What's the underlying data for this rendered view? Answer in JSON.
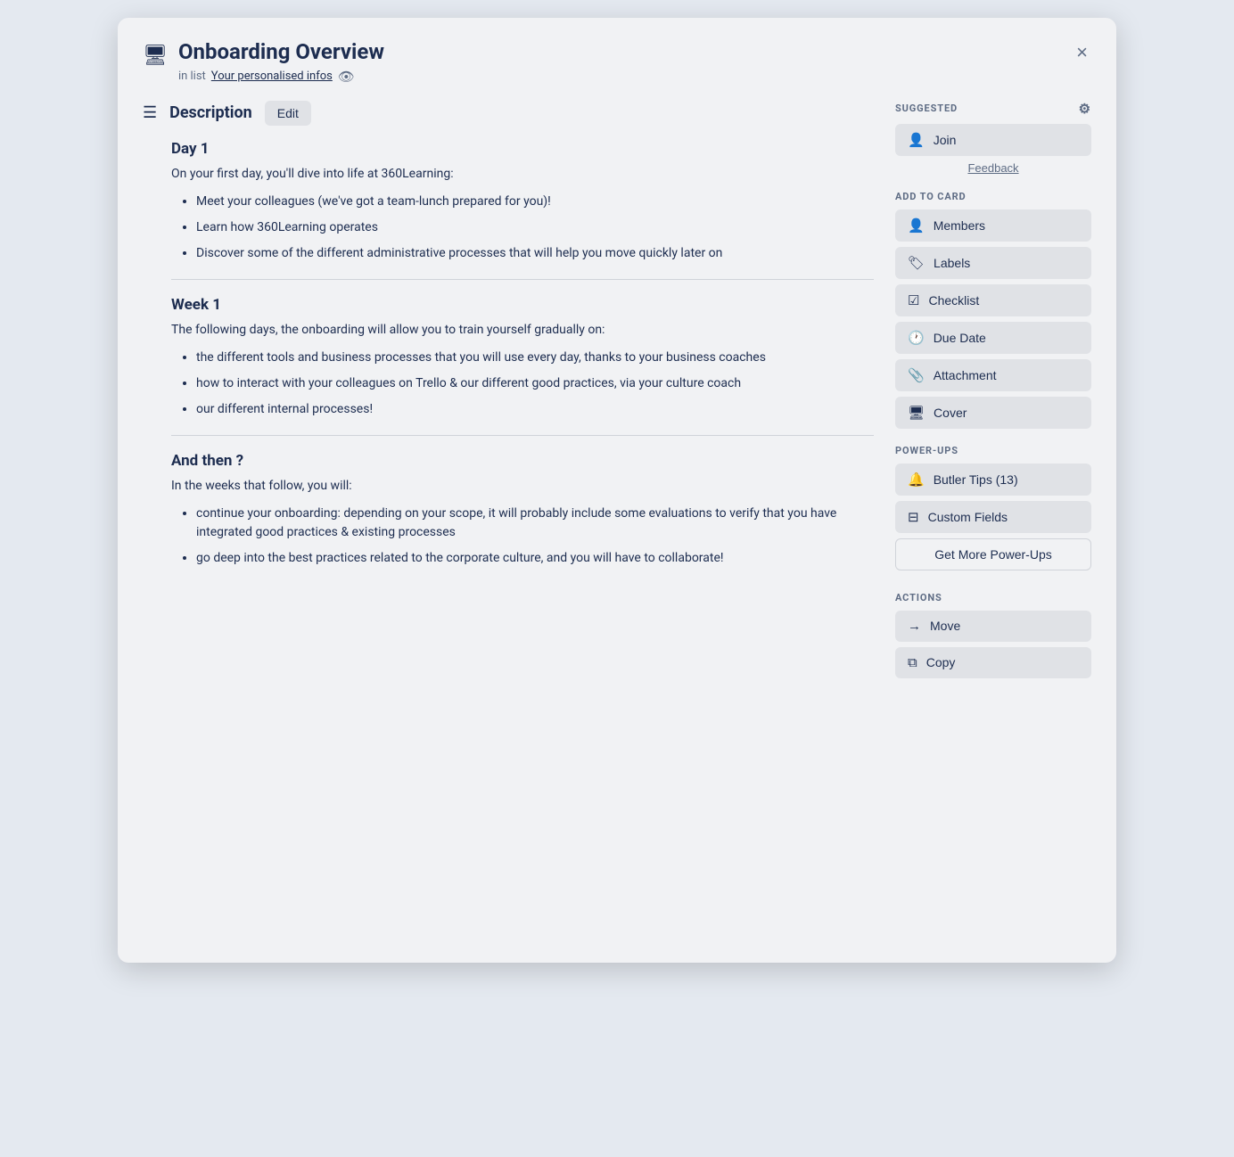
{
  "modal": {
    "title": "Onboarding Overview",
    "list_prefix": "in list",
    "list_name": "Your personalised infos",
    "close_label": "×"
  },
  "description": {
    "label": "Description",
    "edit_button": "Edit",
    "sections": [
      {
        "heading": "Day 1",
        "intro": "On your first day, you'll dive into life at 360Learning:",
        "bullets": [
          "Meet your colleagues (we've got a team-lunch prepared for you)!",
          "Learn how 360Learning operates",
          "Discover some of the different administrative processes that will help you move quickly later on"
        ]
      },
      {
        "heading": "Week 1",
        "intro": "The following days, the onboarding will allow you to train yourself gradually on:",
        "bullets": [
          "the different tools and business processes that you will use every day, thanks to your business coaches",
          "how to interact with your colleagues on Trello & our different good practices, via your culture coach",
          "our different internal processes!"
        ]
      },
      {
        "heading": "And then ?",
        "intro": "In the weeks that follow, you will:",
        "bullets": [
          "continue your onboarding: depending on your scope, it will probably include some evaluations to verify that you have integrated good practices & existing processes",
          "go deep into the best practices related to the corporate culture, and you will have to collaborate!"
        ]
      }
    ]
  },
  "sidebar": {
    "suggested_label": "SUGGESTED",
    "join_label": "Join",
    "feedback_label": "Feedback",
    "add_to_card_label": "ADD TO CARD",
    "buttons": [
      {
        "id": "members",
        "label": "Members",
        "icon": "👤"
      },
      {
        "id": "labels",
        "label": "Labels",
        "icon": "🏷"
      },
      {
        "id": "checklist",
        "label": "Checklist",
        "icon": "☑"
      },
      {
        "id": "due-date",
        "label": "Due Date",
        "icon": "🕐"
      },
      {
        "id": "attachment",
        "label": "Attachment",
        "icon": "📎"
      },
      {
        "id": "cover",
        "label": "Cover",
        "icon": "🖥"
      }
    ],
    "power_ups_label": "POWER-UPS",
    "power_ups": [
      {
        "id": "butler-tips",
        "label": "Butler Tips (13)",
        "icon": "🔔"
      },
      {
        "id": "custom-fields",
        "label": "Custom Fields",
        "icon": "⊟"
      }
    ],
    "get_more_label": "Get More Power-Ups",
    "actions_label": "ACTIONS",
    "actions": [
      {
        "id": "move",
        "label": "Move",
        "icon": "→"
      },
      {
        "id": "copy",
        "label": "Copy",
        "icon": "⧉"
      }
    ]
  }
}
